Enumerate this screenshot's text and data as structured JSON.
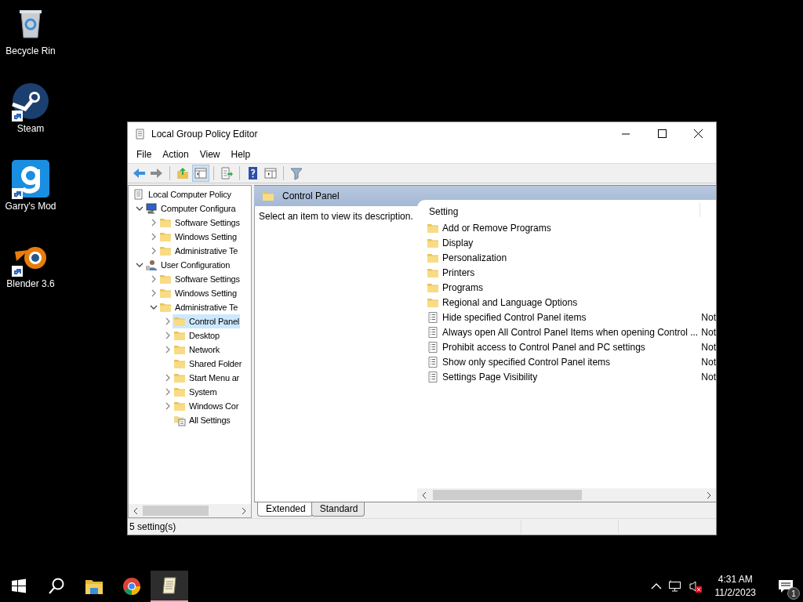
{
  "desktop_icons": [
    {
      "label": "Becycle Rin",
      "kind": "recycle-bin",
      "shortcut": false
    },
    {
      "label": "Steam",
      "kind": "steam",
      "shortcut": true
    },
    {
      "label": "Garry's Mod",
      "kind": "gmod",
      "shortcut": true
    },
    {
      "label": "Blender 3.6",
      "kind": "blender",
      "shortcut": true
    }
  ],
  "window": {
    "title": "Local Group Policy Editor",
    "menu": [
      "File",
      "Action",
      "View",
      "Help"
    ],
    "toolbar": [
      {
        "kind": "back",
        "pressed": false
      },
      {
        "kind": "forward",
        "pressed": false
      },
      {
        "kind": "separator"
      },
      {
        "kind": "up",
        "pressed": false
      },
      {
        "kind": "tree",
        "pressed": true
      },
      {
        "kind": "separator"
      },
      {
        "kind": "export",
        "pressed": false
      },
      {
        "kind": "separator"
      },
      {
        "kind": "help",
        "pressed": false
      },
      {
        "kind": "view",
        "pressed": false
      },
      {
        "kind": "separator"
      },
      {
        "kind": "filter",
        "pressed": false
      }
    ],
    "tree": [
      {
        "label": "Local Computer Policy",
        "kind": "policy",
        "selected": false,
        "children": [
          {
            "label": "Computer Configura",
            "kind": "computer",
            "expandable": true,
            "expanded": true,
            "selected": false,
            "children": [
              {
                "label": "Software Settings",
                "kind": "folder",
                "expandable": true,
                "expanded": false,
                "selected": false
              },
              {
                "label": "Windows Setting",
                "kind": "folder",
                "expandable": true,
                "expanded": false,
                "selected": false
              },
              {
                "label": "Administrative Te",
                "kind": "folder",
                "expandable": true,
                "expanded": false,
                "selected": false
              }
            ]
          },
          {
            "label": "User Configuration",
            "kind": "user",
            "expandable": true,
            "expanded": true,
            "selected": false,
            "children": [
              {
                "label": "Software Settings",
                "kind": "folder",
                "expandable": true,
                "expanded": false,
                "selected": false
              },
              {
                "label": "Windows Setting",
                "kind": "folder",
                "expandable": true,
                "expanded": false,
                "selected": false
              },
              {
                "label": "Administrative Te",
                "kind": "folder",
                "expandable": true,
                "expanded": true,
                "selected": false,
                "children": [
                  {
                    "label": "Control Panel",
                    "kind": "folder",
                    "expandable": true,
                    "expanded": false,
                    "selected": true
                  },
                  {
                    "label": "Desktop",
                    "kind": "folder",
                    "expandable": true,
                    "expanded": false,
                    "selected": false
                  },
                  {
                    "label": "Network",
                    "kind": "folder",
                    "expandable": true,
                    "expanded": false,
                    "selected": false
                  },
                  {
                    "label": "Shared Folder",
                    "kind": "folder",
                    "expandable": false,
                    "selected": false
                  },
                  {
                    "label": "Start Menu ar",
                    "kind": "folder",
                    "expandable": true,
                    "expanded": false,
                    "selected": false
                  },
                  {
                    "label": "System",
                    "kind": "folder",
                    "expandable": true,
                    "expanded": false,
                    "selected": false
                  },
                  {
                    "label": "Windows Cor",
                    "kind": "folder",
                    "expandable": true,
                    "expanded": false,
                    "selected": false
                  },
                  {
                    "label": "All Settings",
                    "kind": "all-settings",
                    "expandable": false,
                    "selected": false
                  }
                ]
              }
            ]
          }
        ]
      }
    ],
    "header_title": "Control Panel",
    "description": "Select an item to view its description.",
    "columns": [
      "Setting"
    ],
    "rows": [
      {
        "kind": "folder",
        "name": "Add or Remove Programs"
      },
      {
        "kind": "folder",
        "name": "Display"
      },
      {
        "kind": "folder",
        "name": "Personalization"
      },
      {
        "kind": "folder",
        "name": "Printers"
      },
      {
        "kind": "folder",
        "name": "Programs"
      },
      {
        "kind": "folder",
        "name": "Regional and Language Options"
      },
      {
        "kind": "setting",
        "name": "Hide specified Control Panel items",
        "column_2": "Not"
      },
      {
        "kind": "setting",
        "name": "Always open All Control Panel Items when opening Control ...",
        "column_2": "Not"
      },
      {
        "kind": "setting",
        "name": "Prohibit access to Control Panel and PC settings",
        "column_2": "Not"
      },
      {
        "kind": "setting",
        "name": "Show only specified Control Panel items",
        "column_2": "Not"
      },
      {
        "kind": "setting",
        "name": "Settings Page Visibility",
        "column_2": "Not"
      }
    ],
    "tabs": [
      {
        "label": "Extended",
        "selected": true
      },
      {
        "label": "Standard",
        "selected": false
      }
    ],
    "status_bar": "5 setting(s)"
  },
  "taskbar": {
    "items": [
      {
        "kind": "start",
        "active": false
      },
      {
        "kind": "search",
        "active": false
      },
      {
        "kind": "explorer",
        "active": false
      },
      {
        "kind": "chrome",
        "active": false
      },
      {
        "kind": "policy",
        "active": true
      }
    ],
    "time": "4:31 AM",
    "date": "11/2/2023",
    "notifications": "1"
  }
}
